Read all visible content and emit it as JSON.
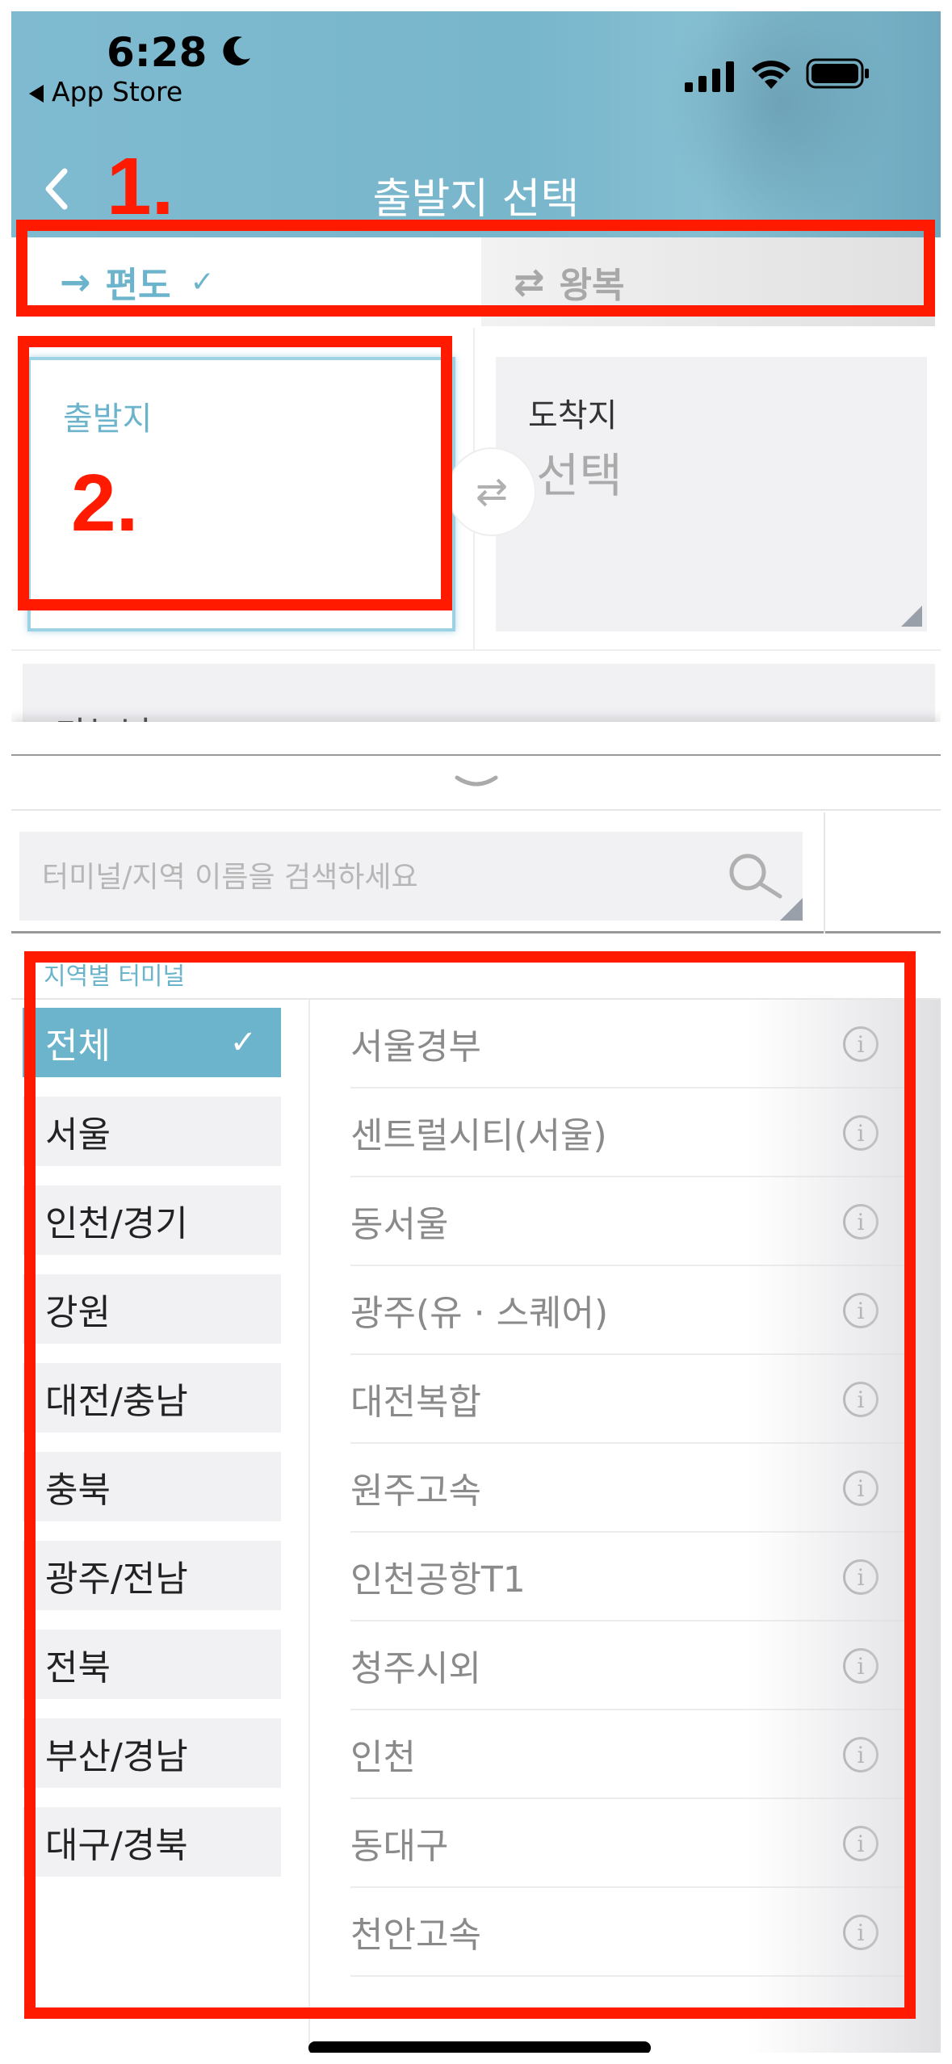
{
  "status_bar": {
    "time": "6:28",
    "back_app": "App Store",
    "icons": [
      "moon-icon",
      "signal-icon",
      "wifi-icon",
      "battery-icon"
    ]
  },
  "nav": {
    "title": "출발지 선택",
    "back_icon": "chevron-left-icon"
  },
  "annotations": {
    "label1": "1.",
    "label2": "2.",
    "color": "#ff1a00"
  },
  "trip_type": {
    "oneway": {
      "label": "편도",
      "arrow": "→",
      "check": "✓",
      "selected": true
    },
    "roundtrip": {
      "label": "왕복",
      "arrow": "⇄",
      "selected": false
    }
  },
  "locations": {
    "origin": {
      "label": "출발지",
      "value": ""
    },
    "destination": {
      "label": "도착지",
      "value": "선택"
    },
    "swap_icon": "⇄",
    "peek_text": "가는날"
  },
  "search": {
    "placeholder": "터미널/지역 이름을 검색하세요"
  },
  "region_caption": "지역별 터미널",
  "regions": [
    {
      "label": "전체",
      "selected": true,
      "check": "✓"
    },
    {
      "label": "서울"
    },
    {
      "label": "인천/경기"
    },
    {
      "label": "강원"
    },
    {
      "label": "대전/충남"
    },
    {
      "label": "충북"
    },
    {
      "label": "광주/전남"
    },
    {
      "label": "전북"
    },
    {
      "label": "부산/경남"
    },
    {
      "label": "대구/경북"
    }
  ],
  "terminals": [
    "서울경부",
    "센트럴시티(서울)",
    "동서울",
    "광주(유 · 스퀘어)",
    "대전복합",
    "원주고속",
    "인천공항T1",
    "청주시외",
    "인천",
    "동대구",
    "천안고속"
  ],
  "info_glyph": "i",
  "colors": {
    "accent": "#6cb4cc",
    "header": "#7fbad0",
    "annotation": "#ff1a00"
  }
}
